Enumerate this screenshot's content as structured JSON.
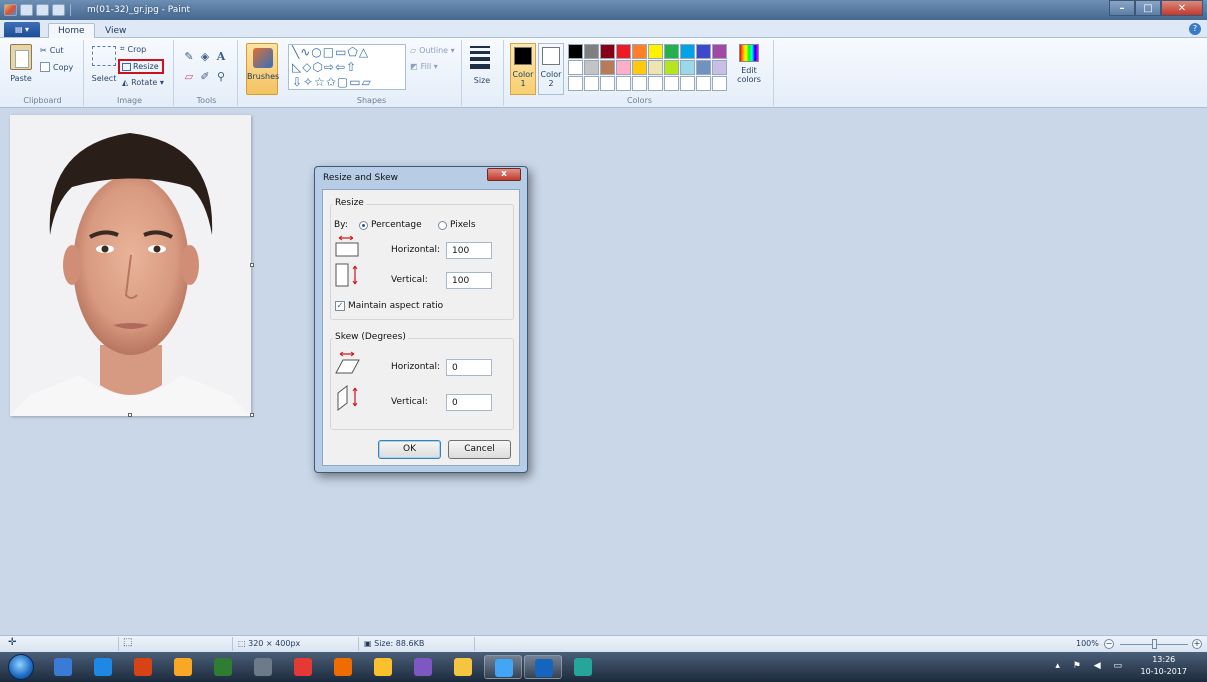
{
  "window": {
    "title": "m(01-32)_gr.jpg - Paint",
    "min": "–",
    "max": "□",
    "close": "✕"
  },
  "tabs": {
    "file": "▤ ▾",
    "home": "Home",
    "view": "View",
    "help": "?"
  },
  "ribbon": {
    "clipboard": {
      "label": "Clipboard",
      "paste": "Paste",
      "cut": "Cut",
      "copy": "Copy"
    },
    "image": {
      "label": "Image",
      "select": "Select",
      "crop": "Crop",
      "resize": "Resize",
      "rotate": "Rotate ▾"
    },
    "tools": {
      "label": "Tools",
      "pencil": "✎",
      "fill": "◈",
      "text": "A",
      "eraser": "▱",
      "picker": "✐",
      "magnifier": "⚲"
    },
    "brushes": {
      "label": "Brushes"
    },
    "shapes": {
      "label": "Shapes",
      "row1": "╲∿○□▭⬠△",
      "row2": "◺◇⬡⇨⇦⇧",
      "row3": "⇩✧☆✩▢▭▱",
      "outline": "Outline ▾",
      "fill": "Fill ▾"
    },
    "size": {
      "label": "Size"
    },
    "colors": {
      "label": "Colors",
      "color1": "Color 1",
      "color2": "Color 2",
      "edit": "Edit colors",
      "color1_value": "#000000",
      "color2_value": "#ffffff",
      "palette": [
        "#000000",
        "#7f7f7f",
        "#880015",
        "#ed1c24",
        "#ff7f27",
        "#fff200",
        "#22b14c",
        "#00a2e8",
        "#3f48cc",
        "#a349a4",
        "#ffffff",
        "#c3c3c3",
        "#b97a57",
        "#ffaec9",
        "#ffc90e",
        "#efe4b0",
        "#b5e61d",
        "#99d9ea",
        "#7092be",
        "#c8bfe7",
        "#ffffff",
        "#ffffff",
        "#ffffff",
        "#ffffff",
        "#ffffff",
        "#ffffff",
        "#ffffff",
        "#ffffff",
        "#ffffff",
        "#ffffff"
      ]
    }
  },
  "dialog": {
    "title": "Resize and Skew",
    "close": "x",
    "resize": {
      "legend": "Resize",
      "by_label": "By:",
      "percentage": "Percentage",
      "pixels": "Pixels",
      "horizontal_label": "Horizontal:",
      "horizontal_value": "100",
      "vertical_label": "Vertical:",
      "vertical_value": "100",
      "maintain": "Maintain aspect ratio"
    },
    "skew": {
      "legend": "Skew (Degrees)",
      "horizontal_label": "Horizontal:",
      "horizontal_value": "0",
      "vertical_label": "Vertical:",
      "vertical_value": "0"
    },
    "ok": "OK",
    "cancel": "Cancel"
  },
  "statusbar": {
    "cursor_icon": "✛",
    "selection_icon": "⬚",
    "image_size": "320 × 400px",
    "file_size": "Size: 88.6KB",
    "zoom": "100%",
    "zoom_out": "−",
    "zoom_in": "+"
  },
  "taskbar": {
    "time": "13:26",
    "date": "10-10-2017",
    "tray": "▴ ⚑ ◀ ▭",
    "apps": [
      {
        "name": "media-player",
        "color": "#3a7bd5"
      },
      {
        "name": "internet-explorer",
        "color": "#1e88e5"
      },
      {
        "name": "app-3",
        "color": "#d84315"
      },
      {
        "name": "app-4",
        "color": "#f9a825"
      },
      {
        "name": "excel",
        "color": "#2e7d32"
      },
      {
        "name": "app-6",
        "color": "#6d7a8a"
      },
      {
        "name": "chrome",
        "color": "#e53935"
      },
      {
        "name": "firefox",
        "color": "#ef6c00"
      },
      {
        "name": "app-9",
        "color": "#fbc02d"
      },
      {
        "name": "app-10",
        "color": "#7e57c2"
      },
      {
        "name": "file-explorer",
        "color": "#f5c542"
      },
      {
        "name": "paint",
        "color": "#42a5f5"
      },
      {
        "name": "word",
        "color": "#1565c0"
      },
      {
        "name": "app-14",
        "color": "#26a69a"
      }
    ]
  }
}
